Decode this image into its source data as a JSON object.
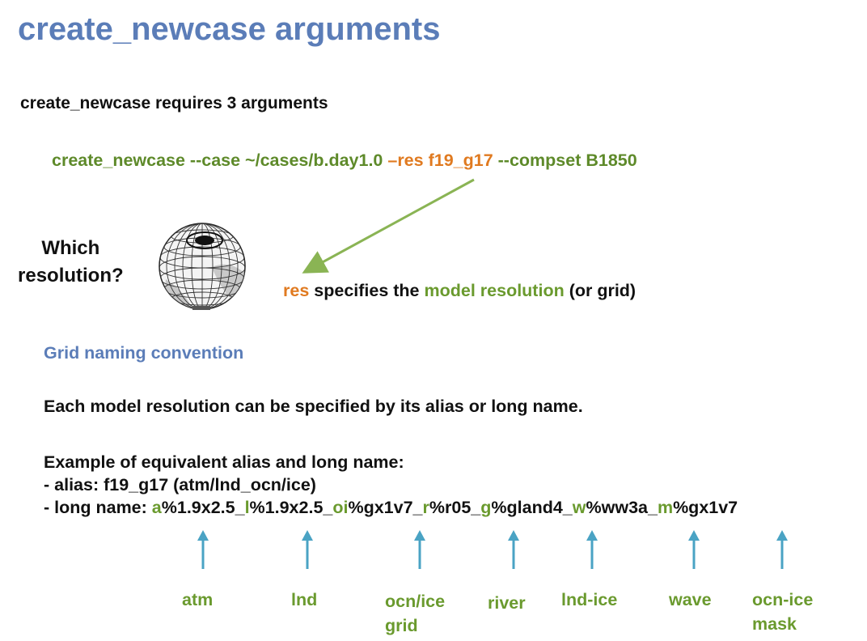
{
  "title": "create_newcase arguments",
  "intro": "create_newcase requires 3 arguments",
  "command": {
    "part1": "create_newcase --case ~/cases/b.day1.0 ",
    "res_flag": "–res f19_g17",
    "part3": " --compset B1850"
  },
  "question": {
    "line1": "Which",
    "line2": "resolution?"
  },
  "res_desc": {
    "res": "res",
    "mid": " specifies the ",
    "model_resolution": "model resolution",
    "tail": " (or grid)"
  },
  "grid_heading": "Grid naming convention",
  "each_text": "Each model resolution can be specified by its alias or long name.",
  "example": {
    "header": "Example of equivalent alias and long name:",
    "alias_line": "- alias: f19_g17  (atm/lnd_ocn/ice)",
    "long_name_prefix": "- long name: ",
    "segments": [
      {
        "prefix": "a",
        "value": "%1.9x2.5_"
      },
      {
        "prefix": "l",
        "value": "%1.9x2.5_"
      },
      {
        "prefix": "oi",
        "value": "%gx1v7_"
      },
      {
        "prefix": "r",
        "value": "%r05_"
      },
      {
        "prefix": "g",
        "value": "%gland4_"
      },
      {
        "prefix": "w",
        "value": "%ww3a_"
      },
      {
        "prefix": "m",
        "value": "%gx1v7"
      }
    ]
  },
  "component_labels": {
    "atm": "atm",
    "lnd": "lnd",
    "ocn_ice_grid_1": "ocn/ice",
    "ocn_ice_grid_2": "grid",
    "river": "river",
    "lnd_ice": "lnd-ice",
    "wave": "wave",
    "ocn_ice_mask_1": "ocn-ice",
    "ocn_ice_mask_2": "mask"
  },
  "colors": {
    "title_blue": "#5b7db8",
    "command_green": "#5e8a2a",
    "accent_orange": "#e07a20",
    "label_green": "#6a9a2e",
    "arrow_green": "#8ab454",
    "arrow_teal": "#4aa3c4"
  },
  "icons": [
    "globe-wireframe-icon"
  ]
}
